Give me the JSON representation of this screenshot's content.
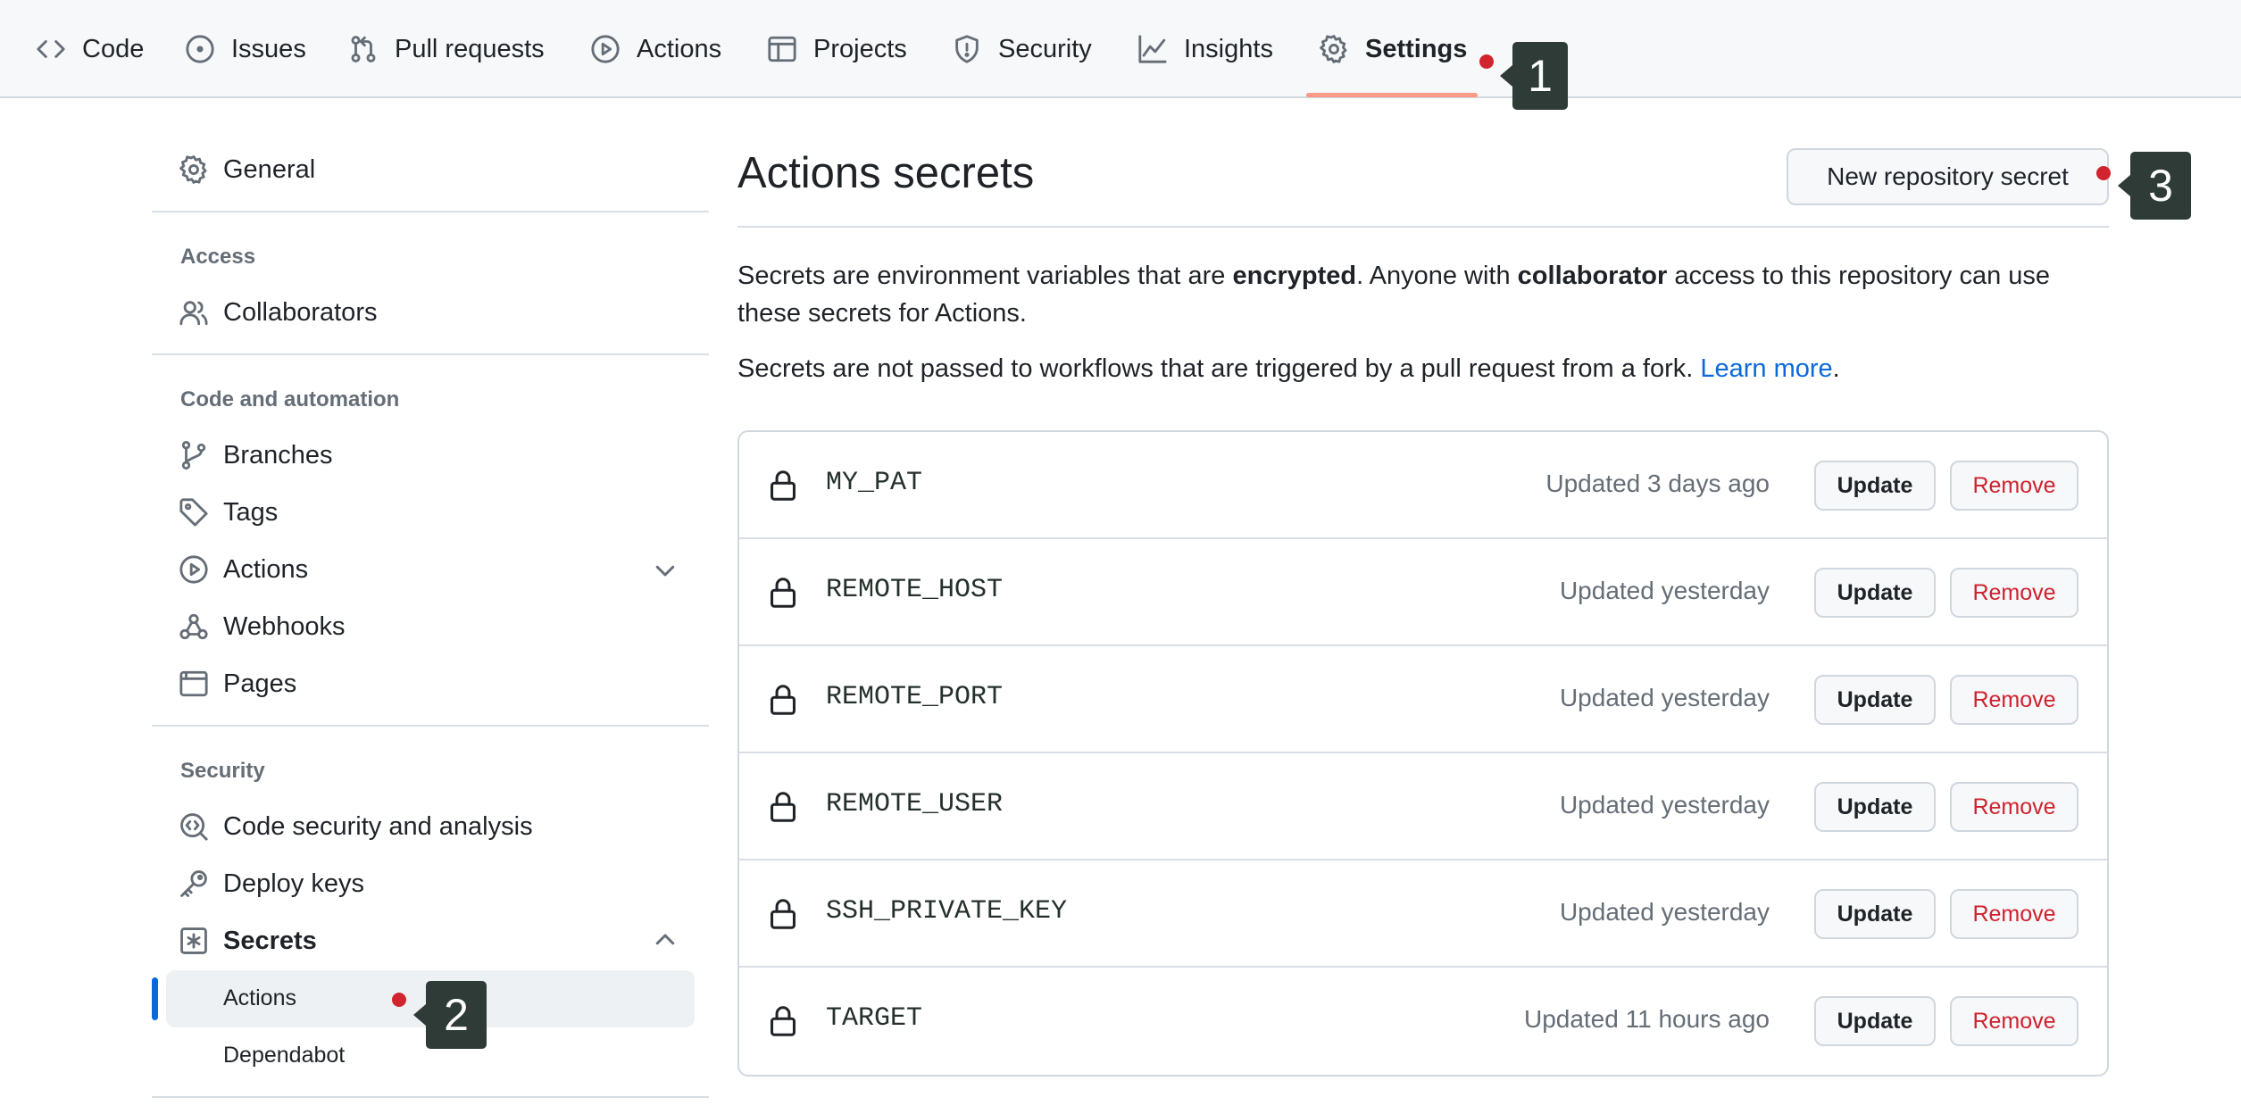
{
  "nav": {
    "tabs": [
      {
        "label": "Code",
        "icon": "code-icon"
      },
      {
        "label": "Issues",
        "icon": "issue-circle-icon"
      },
      {
        "label": "Pull requests",
        "icon": "pull-request-icon"
      },
      {
        "label": "Actions",
        "icon": "play-icon"
      },
      {
        "label": "Projects",
        "icon": "table-icon"
      },
      {
        "label": "Security",
        "icon": "shield-icon"
      },
      {
        "label": "Insights",
        "icon": "graph-icon"
      },
      {
        "label": "Settings",
        "icon": "gear-icon"
      }
    ],
    "active_tab": "Settings"
  },
  "markers": [
    "1",
    "2",
    "3"
  ],
  "sidebar": {
    "general": "General",
    "access_heading": "Access",
    "collaborators": "Collaborators",
    "code_heading": "Code and automation",
    "branches": "Branches",
    "tags": "Tags",
    "actions": "Actions",
    "webhooks": "Webhooks",
    "pages": "Pages",
    "security_heading": "Security",
    "code_security": "Code security and analysis",
    "deploy_keys": "Deploy keys",
    "secrets": "Secrets",
    "secrets_actions": "Actions",
    "secrets_dependabot": "Dependabot"
  },
  "main": {
    "title": "Actions secrets",
    "new_button": "New repository secret",
    "desc1_a": "Secrets are environment variables that are ",
    "desc1_b": "encrypted",
    "desc1_c": ". Anyone with ",
    "desc1_d": "collaborator",
    "desc1_e": " access to this repository can use these secrets for Actions.",
    "desc2_a": "Secrets are not passed to workflows that are triggered by a pull request from a fork. ",
    "desc2_link": "Learn more",
    "desc2_b": ".",
    "update_label": "Update",
    "remove_label": "Remove",
    "secrets": [
      {
        "name": "MY_PAT",
        "updated": "Updated 3 days ago"
      },
      {
        "name": "REMOTE_HOST",
        "updated": "Updated yesterday"
      },
      {
        "name": "REMOTE_PORT",
        "updated": "Updated yesterday"
      },
      {
        "name": "REMOTE_USER",
        "updated": "Updated yesterday"
      },
      {
        "name": "SSH_PRIVATE_KEY",
        "updated": "Updated yesterday"
      },
      {
        "name": "TARGET",
        "updated": "Updated 11 hours ago"
      }
    ]
  },
  "colors": {
    "accent_blue": "#0969da",
    "remove_red": "#cf222e",
    "marker_red": "#d1242f",
    "badge_bg": "#2e3b36"
  }
}
